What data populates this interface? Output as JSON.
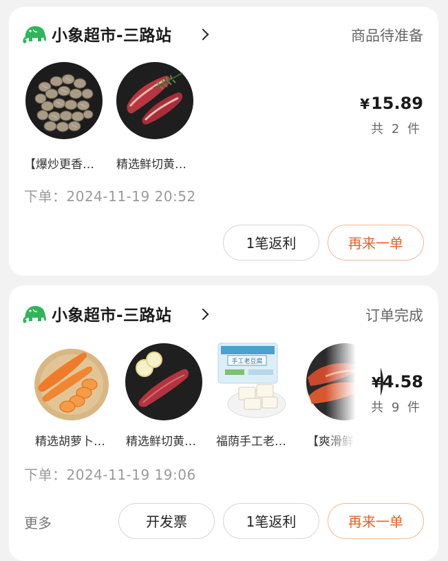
{
  "orders": [
    {
      "store_name": "小象超市-三路站",
      "status": "商品待准备",
      "products": [
        {
          "name": "【爆炒更香…",
          "image": "clams"
        },
        {
          "name": "精选鲜切黄…",
          "image": "beef-rosemary"
        }
      ],
      "price_symbol": "¥",
      "price": "15.89",
      "count_text": "共 2 件",
      "order_time": "下单：2024-11-19 20:52",
      "buttons": {
        "rebate": "1笔返利",
        "reorder": "再来一单"
      }
    },
    {
      "store_name": "小象超市-三路站",
      "status": "订单完成",
      "products": [
        {
          "name": "精选胡萝卜…",
          "image": "carrots"
        },
        {
          "name": "精选鲜切黄…",
          "image": "beef-lemon"
        },
        {
          "name": "福荫手工老…",
          "image": "tofu"
        },
        {
          "name": "【爽滑鲜…",
          "image": "sweet-potato"
        }
      ],
      "price_symbol": "¥",
      "price": "4.58",
      "count_text": "共 9 件",
      "order_time": "下单：2024-11-19 19:06",
      "more": "更多",
      "buttons": {
        "invoice": "开发票",
        "rebate": "1笔返利",
        "reorder": "再来一单"
      }
    }
  ],
  "tofu_package_label": "手工老豆腐",
  "colors": {
    "brand_green": "#2fb55a",
    "reorder_orange": "#e8622a",
    "reorder_border": "#f0b896"
  }
}
